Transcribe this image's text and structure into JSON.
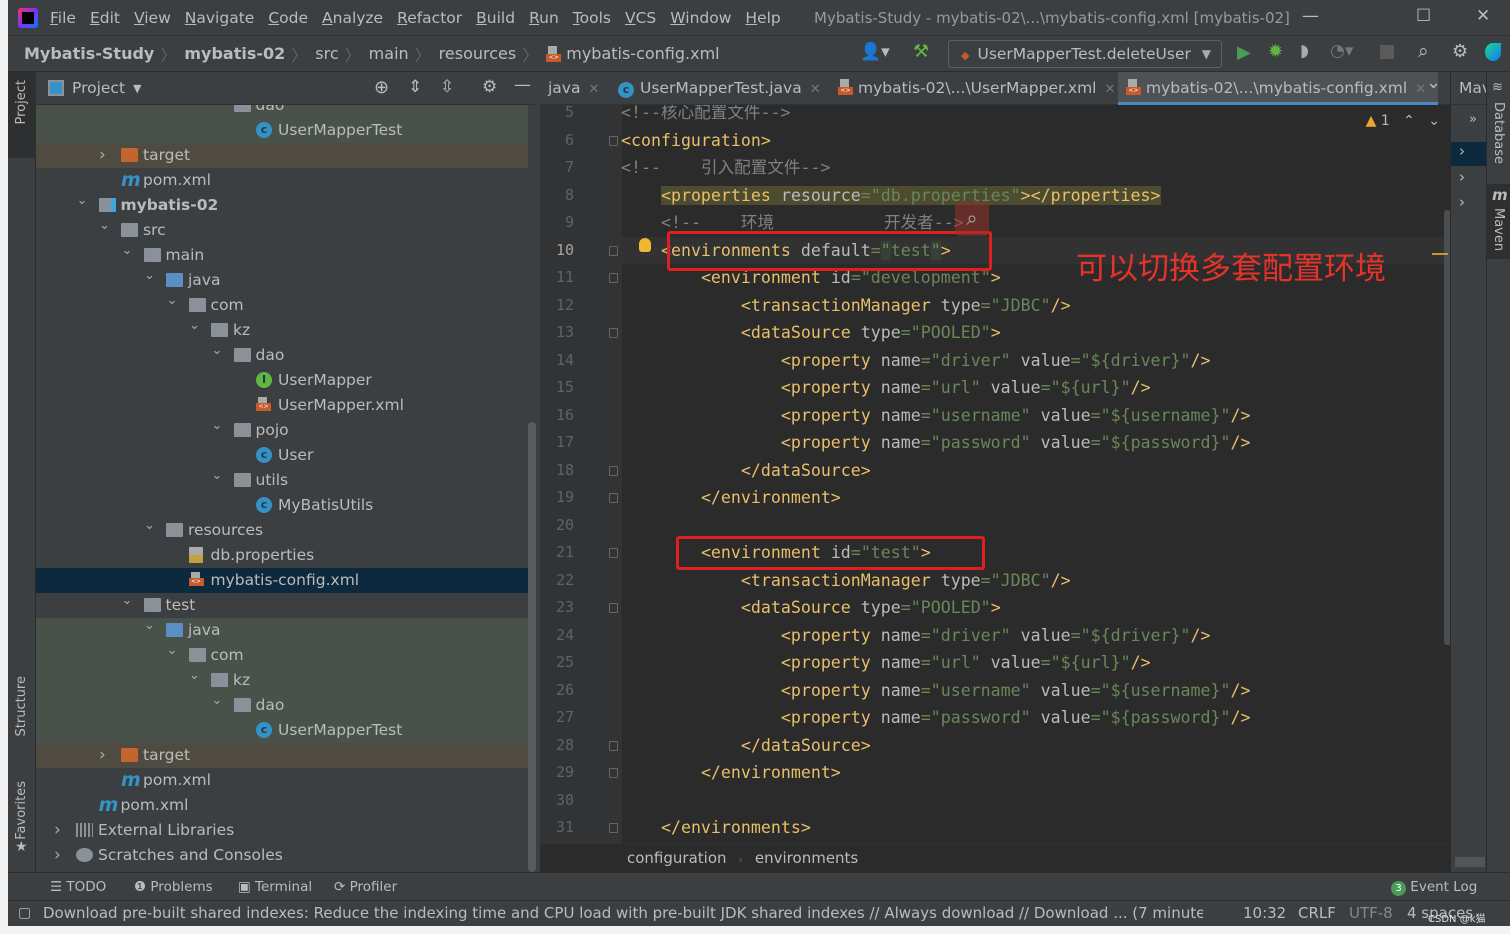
{
  "title_bar": {
    "menus": [
      "File",
      "Edit",
      "View",
      "Navigate",
      "Code",
      "Analyze",
      "Refactor",
      "Build",
      "Run",
      "Tools",
      "VCS",
      "Window",
      "Help"
    ],
    "window_title": "Mybatis-Study - mybatis-02\\...\\mybatis-config.xml [mybatis-02]",
    "minimize": "—",
    "maximize": "☐",
    "close": "✕"
  },
  "nav": {
    "breadcrumbs": [
      "Mybatis-Study",
      "mybatis-02",
      "src",
      "main",
      "resources",
      "mybatis-config.xml"
    ],
    "run_config": "UserMapperTest.deleteUser"
  },
  "left_stripe": {
    "project": "Project",
    "structure": "Structure",
    "favorites": "Favorites"
  },
  "project_panel": {
    "title": "Project",
    "tree": [
      {
        "label": "dao",
        "depth": 7,
        "icon": "folder",
        "arrow": "open",
        "bg": "green"
      },
      {
        "label": "UserMapperTest",
        "depth": 8,
        "icon": "class",
        "bg": "green"
      },
      {
        "label": "target",
        "depth": 2,
        "icon": "folder-orange",
        "arrow": "closed",
        "bg": "brown"
      },
      {
        "label": "pom.xml",
        "depth": 2,
        "icon": "maven"
      },
      {
        "label": "mybatis-02",
        "depth": 1,
        "icon": "module",
        "arrow": "open",
        "bold": true
      },
      {
        "label": "src",
        "depth": 2,
        "icon": "folder",
        "arrow": "open"
      },
      {
        "label": "main",
        "depth": 3,
        "icon": "folder",
        "arrow": "open"
      },
      {
        "label": "java",
        "depth": 4,
        "icon": "folder-blue",
        "arrow": "open"
      },
      {
        "label": "com",
        "depth": 5,
        "icon": "folder",
        "arrow": "open"
      },
      {
        "label": "kz",
        "depth": 6,
        "icon": "folder",
        "arrow": "open"
      },
      {
        "label": "dao",
        "depth": 7,
        "icon": "folder",
        "arrow": "open"
      },
      {
        "label": "UserMapper",
        "depth": 8,
        "icon": "interface"
      },
      {
        "label": "UserMapper.xml",
        "depth": 8,
        "icon": "xml"
      },
      {
        "label": "pojo",
        "depth": 7,
        "icon": "folder",
        "arrow": "open"
      },
      {
        "label": "User",
        "depth": 8,
        "icon": "class"
      },
      {
        "label": "utils",
        "depth": 7,
        "icon": "folder",
        "arrow": "open"
      },
      {
        "label": "MyBatisUtils",
        "depth": 8,
        "icon": "class"
      },
      {
        "label": "resources",
        "depth": 4,
        "icon": "folder",
        "arrow": "open"
      },
      {
        "label": "db.properties",
        "depth": 5,
        "icon": "properties"
      },
      {
        "label": "mybatis-config.xml",
        "depth": 5,
        "icon": "xml",
        "selected": true
      },
      {
        "label": "test",
        "depth": 3,
        "icon": "folder",
        "arrow": "open"
      },
      {
        "label": "java",
        "depth": 4,
        "icon": "folder-blue",
        "arrow": "open",
        "bg": "green"
      },
      {
        "label": "com",
        "depth": 5,
        "icon": "folder",
        "arrow": "open",
        "bg": "green"
      },
      {
        "label": "kz",
        "depth": 6,
        "icon": "folder",
        "arrow": "open",
        "bg": "green"
      },
      {
        "label": "dao",
        "depth": 7,
        "icon": "folder",
        "arrow": "open",
        "bg": "green"
      },
      {
        "label": "UserMapperTest",
        "depth": 8,
        "icon": "class",
        "bg": "green"
      },
      {
        "label": "target",
        "depth": 2,
        "icon": "folder-orange",
        "arrow": "closed",
        "bg": "brown"
      },
      {
        "label": "pom.xml",
        "depth": 2,
        "icon": "maven"
      },
      {
        "label": "pom.xml",
        "depth": 1,
        "icon": "maven"
      },
      {
        "label": "External Libraries",
        "depth": 0,
        "icon": "libraries",
        "arrow": "closed"
      },
      {
        "label": "Scratches and Consoles",
        "depth": 0,
        "icon": "scratches",
        "arrow": "closed"
      }
    ]
  },
  "editor_tabs": [
    {
      "label": "java",
      "active": false
    },
    {
      "label": "UserMapperTest.java",
      "active": false
    },
    {
      "label": "mybatis-02\\...\\UserMapper.xml",
      "active": false
    },
    {
      "label": "mybatis-02\\...\\mybatis-config.xml",
      "active": true
    }
  ],
  "editor": {
    "warning_count": "1",
    "current_line": 10,
    "annotation": "可以切换多套配置环境",
    "lines": [
      {
        "n": "5",
        "indent": 0,
        "tokens": [
          [
            "com",
            "<!--核心配置文件-->"
          ]
        ]
      },
      {
        "n": "6",
        "indent": 0,
        "fold": true,
        "tokens": [
          [
            "tag",
            "<configuration>"
          ]
        ]
      },
      {
        "n": "7",
        "indent": 0,
        "tokens": [
          [
            "com",
            "<!--    引入配置文件-->"
          ]
        ]
      },
      {
        "n": "8",
        "indent": 4,
        "hl": true,
        "tokens": [
          [
            "tag",
            "<properties"
          ],
          [
            "attr",
            " resource"
          ],
          [
            "eq",
            "="
          ],
          [
            "str",
            "\"db.properties\""
          ],
          [
            "tag",
            "></properties>"
          ]
        ]
      },
      {
        "n": "9",
        "indent": 4,
        "tokens": [
          [
            "com",
            "<!--    环境           开发者-->"
          ]
        ]
      },
      {
        "n": "10",
        "indent": 4,
        "fold": true,
        "tokens": [
          [
            "tag",
            "<environments"
          ],
          [
            "attr",
            " default"
          ],
          [
            "eq",
            "="
          ],
          [
            "q",
            "\""
          ],
          [
            "str",
            "test"
          ],
          [
            "q",
            "\""
          ],
          [
            "tag",
            ">"
          ]
        ]
      },
      {
        "n": "11",
        "indent": 8,
        "fold": true,
        "tokens": [
          [
            "tag",
            "<environment"
          ],
          [
            "attr",
            " id"
          ],
          [
            "eq",
            "="
          ],
          [
            "str",
            "\"development\""
          ],
          [
            "tag",
            ">"
          ]
        ]
      },
      {
        "n": "12",
        "indent": 12,
        "tokens": [
          [
            "tag",
            "<transactionManager"
          ],
          [
            "attr",
            " type"
          ],
          [
            "eq",
            "="
          ],
          [
            "str",
            "\"JDBC\""
          ],
          [
            "tag",
            "/>"
          ]
        ]
      },
      {
        "n": "13",
        "indent": 12,
        "fold": true,
        "tokens": [
          [
            "tag",
            "<dataSource"
          ],
          [
            "attr",
            " type"
          ],
          [
            "eq",
            "="
          ],
          [
            "str",
            "\"POOLED\""
          ],
          [
            "tag",
            ">"
          ]
        ]
      },
      {
        "n": "14",
        "indent": 16,
        "tokens": [
          [
            "tag",
            "<property"
          ],
          [
            "attr",
            " name"
          ],
          [
            "eq",
            "="
          ],
          [
            "str",
            "\"driver\""
          ],
          [
            "attr",
            " value"
          ],
          [
            "eq",
            "="
          ],
          [
            "str",
            "\"${driver}\""
          ],
          [
            "tag",
            "/>"
          ]
        ]
      },
      {
        "n": "15",
        "indent": 16,
        "tokens": [
          [
            "tag",
            "<property"
          ],
          [
            "attr",
            " name"
          ],
          [
            "eq",
            "="
          ],
          [
            "str",
            "\"url\""
          ],
          [
            "attr",
            " value"
          ],
          [
            "eq",
            "="
          ],
          [
            "str",
            "\"${url}\""
          ],
          [
            "tag",
            "/>"
          ]
        ]
      },
      {
        "n": "16",
        "indent": 16,
        "tokens": [
          [
            "tag",
            "<property"
          ],
          [
            "attr",
            " name"
          ],
          [
            "eq",
            "="
          ],
          [
            "str",
            "\"username\""
          ],
          [
            "attr",
            " value"
          ],
          [
            "eq",
            "="
          ],
          [
            "str",
            "\"${username}\""
          ],
          [
            "tag",
            "/>"
          ]
        ]
      },
      {
        "n": "17",
        "indent": 16,
        "tokens": [
          [
            "tag",
            "<property"
          ],
          [
            "attr",
            " name"
          ],
          [
            "eq",
            "="
          ],
          [
            "str",
            "\"password\""
          ],
          [
            "attr",
            " value"
          ],
          [
            "eq",
            "="
          ],
          [
            "str",
            "\"${password}\""
          ],
          [
            "tag",
            "/>"
          ]
        ]
      },
      {
        "n": "18",
        "indent": 12,
        "fold": true,
        "tokens": [
          [
            "tag",
            "</dataSource>"
          ]
        ]
      },
      {
        "n": "19",
        "indent": 8,
        "fold": true,
        "tokens": [
          [
            "tag",
            "</environment>"
          ]
        ]
      },
      {
        "n": "20",
        "indent": 0,
        "tokens": []
      },
      {
        "n": "21",
        "indent": 8,
        "fold": true,
        "tokens": [
          [
            "tag",
            "<environment"
          ],
          [
            "attr",
            " id"
          ],
          [
            "eq",
            "="
          ],
          [
            "str",
            "\"test\""
          ],
          [
            "tag",
            ">"
          ]
        ]
      },
      {
        "n": "22",
        "indent": 12,
        "tokens": [
          [
            "tag",
            "<transactionManager"
          ],
          [
            "attr",
            " type"
          ],
          [
            "eq",
            "="
          ],
          [
            "str",
            "\"JDBC\""
          ],
          [
            "tag",
            "/>"
          ]
        ]
      },
      {
        "n": "23",
        "indent": 12,
        "fold": true,
        "tokens": [
          [
            "tag",
            "<dataSource"
          ],
          [
            "attr",
            " type"
          ],
          [
            "eq",
            "="
          ],
          [
            "str",
            "\"POOLED\""
          ],
          [
            "tag",
            ">"
          ]
        ]
      },
      {
        "n": "24",
        "indent": 16,
        "tokens": [
          [
            "tag",
            "<property"
          ],
          [
            "attr",
            " name"
          ],
          [
            "eq",
            "="
          ],
          [
            "str",
            "\"driver\""
          ],
          [
            "attr",
            " value"
          ],
          [
            "eq",
            "="
          ],
          [
            "str",
            "\"${driver}\""
          ],
          [
            "tag",
            "/>"
          ]
        ]
      },
      {
        "n": "25",
        "indent": 16,
        "tokens": [
          [
            "tag",
            "<property"
          ],
          [
            "attr",
            " name"
          ],
          [
            "eq",
            "="
          ],
          [
            "str",
            "\"url\""
          ],
          [
            "attr",
            " value"
          ],
          [
            "eq",
            "="
          ],
          [
            "str",
            "\"${url}\""
          ],
          [
            "tag",
            "/>"
          ]
        ]
      },
      {
        "n": "26",
        "indent": 16,
        "tokens": [
          [
            "tag",
            "<property"
          ],
          [
            "attr",
            " name"
          ],
          [
            "eq",
            "="
          ],
          [
            "str",
            "\"username\""
          ],
          [
            "attr",
            " value"
          ],
          [
            "eq",
            "="
          ],
          [
            "str",
            "\"${username}\""
          ],
          [
            "tag",
            "/>"
          ]
        ]
      },
      {
        "n": "27",
        "indent": 16,
        "tokens": [
          [
            "tag",
            "<property"
          ],
          [
            "attr",
            " name"
          ],
          [
            "eq",
            "="
          ],
          [
            "str",
            "\"password\""
          ],
          [
            "attr",
            " value"
          ],
          [
            "eq",
            "="
          ],
          [
            "str",
            "\"${password}\""
          ],
          [
            "tag",
            "/>"
          ]
        ]
      },
      {
        "n": "28",
        "indent": 12,
        "fold": true,
        "tokens": [
          [
            "tag",
            "</dataSource>"
          ]
        ]
      },
      {
        "n": "29",
        "indent": 8,
        "fold": true,
        "tokens": [
          [
            "tag",
            "</environment>"
          ]
        ]
      },
      {
        "n": "30",
        "indent": 0,
        "tokens": []
      },
      {
        "n": "31",
        "indent": 4,
        "fold": true,
        "tokens": [
          [
            "tag",
            "</environments>"
          ]
        ]
      }
    ],
    "breadcrumb": [
      "configuration",
      "environments"
    ]
  },
  "right_panel": {
    "maven_header": "Mav",
    "expand": "»",
    "database": "Database",
    "maven": "Maven"
  },
  "tool_windows": {
    "todo": "TODO",
    "problems": "Problems",
    "terminal": "Terminal",
    "profiler": "Profiler",
    "event_log": "Event Log",
    "event_count": "3"
  },
  "status_bar": {
    "message": "Download pre-built shared indexes: Reduce the indexing time and CPU load with pre-built JDK shared indexes // Always download // Download ... (7 minutes ago)",
    "position": "10:32",
    "line_sep": "CRLF",
    "encoding": "UTF-8",
    "indent": "4 spaces",
    "watermark": "CSDN @k猫"
  },
  "colors": {
    "accent": "#4a88c7",
    "annotation": "#e6332a",
    "tag": "#e8bf6a",
    "string": "#6a8759",
    "comment": "#808080"
  }
}
